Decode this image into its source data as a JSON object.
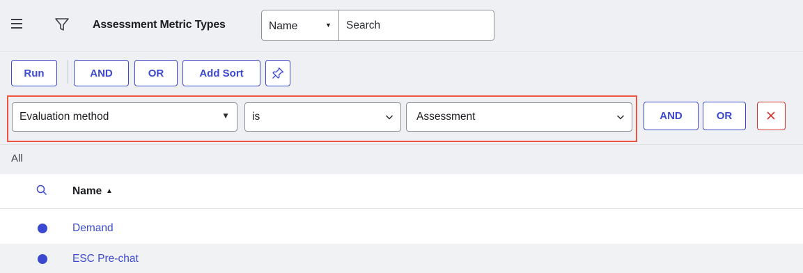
{
  "header": {
    "title": "Assessment Metric Types",
    "field_select": "Name",
    "search_placeholder": "Search"
  },
  "toolbar": {
    "run_label": "Run",
    "and_label": "AND",
    "or_label": "OR",
    "add_sort_label": "Add Sort"
  },
  "condition": {
    "field": "Evaluation method",
    "operator": "is",
    "value": "Assessment",
    "and_label": "AND",
    "or_label": "OR"
  },
  "breadcrumb": {
    "all_label": "All"
  },
  "table": {
    "column_name": "Name",
    "rows": [
      {
        "name": "Demand"
      },
      {
        "name": "ESC Pre-chat"
      }
    ]
  },
  "colors": {
    "accent": "#3c48cf",
    "highlight": "#ee5440",
    "delete": "#d3312a",
    "panel_bg": "#eef0f3"
  },
  "icons": [
    "menu-icon",
    "filter-icon",
    "pin-icon",
    "delete-icon",
    "search-icon",
    "sort-up-icon",
    "chevron-down-icon"
  ]
}
